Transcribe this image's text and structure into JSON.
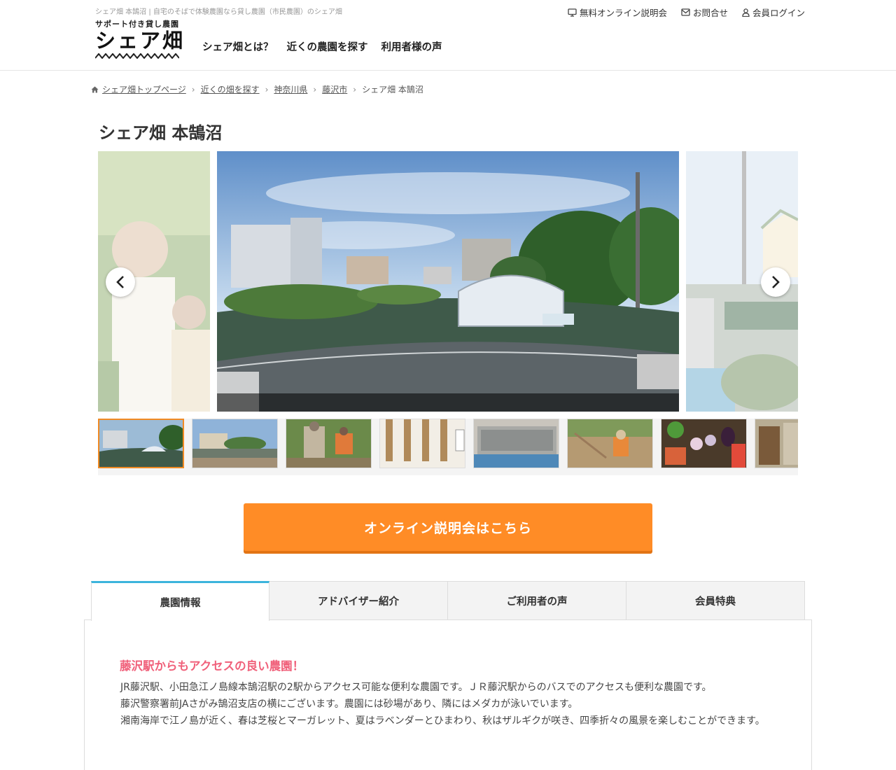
{
  "header": {
    "site_description": "シェア畑 本鵠沼 | 自宅のそばで体験農園なら貸し農園（市民農園）のシェア畑",
    "logo_sub": "サポート付き貸し農園",
    "logo_main": "シェア畑",
    "nav": [
      {
        "label": "シェア畑とは？"
      },
      {
        "label": "近くの農園を探す"
      },
      {
        "label": "利用者様の声"
      }
    ],
    "top_links": [
      {
        "label": "無料オンライン説明会",
        "icon": "monitor-icon"
      },
      {
        "label": "お問合せ",
        "icon": "mail-icon"
      },
      {
        "label": "会員ログイン",
        "icon": "user-icon"
      }
    ]
  },
  "breadcrumb": {
    "items": [
      {
        "label": "シェア畑トップページ"
      },
      {
        "label": "近くの畑を探す"
      },
      {
        "label": "神奈川県"
      },
      {
        "label": "藤沢市"
      }
    ],
    "current": "シェア畑 本鵠沼"
  },
  "page_title": "シェア畑 本鵠沼",
  "gallery": {
    "thumbnail_count": 8,
    "active_index": 0
  },
  "cta": {
    "label": "オンライン説明会はこちら"
  },
  "tabs": [
    {
      "label": "農園情報",
      "active": true
    },
    {
      "label": "アドバイザー紹介",
      "active": false
    },
    {
      "label": "ご利用者の声",
      "active": false
    },
    {
      "label": "会員特典",
      "active": false
    }
  ],
  "farm_info": {
    "heading": "藤沢駅からもアクセスの良い農園！",
    "paragraphs": [
      "JR藤沢駅、小田急江ノ島線本鵠沼駅の2駅からアクセス可能な便利な農園です。ＪＲ藤沢駅からのバスでのアクセスも便利な農園です。",
      "藤沢警察署前JAさがみ鵠沼支店の横にございます。農園には砂場があり、隣にはメダカが泳いでいます。",
      "湘南海岸で江ノ島が近く、春は芝桜とマーガレット、夏はラベンダーとひまわり、秋はザルギクが咲き、四季折々の風景を楽しむことができます。"
    ]
  },
  "colors": {
    "accent_orange": "#ff8c26",
    "tab_accent_blue": "#3cb4dc",
    "heading_pink": "#f0607a"
  }
}
